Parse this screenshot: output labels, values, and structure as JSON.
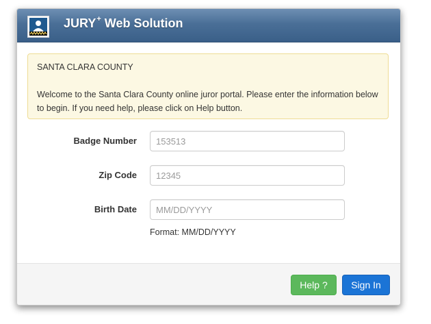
{
  "header": {
    "title": "JURY",
    "title_sup": "+",
    "title_rest": " Web Solution",
    "logo_icon": "jury-box-logo-icon"
  },
  "notice": {
    "county": "SANTA CLARA COUNTY",
    "message": "Welcome to the Santa Clara County online juror portal. Please enter the information below to begin. If you need help, please click on Help button."
  },
  "form": {
    "badge_label": "Badge Number",
    "badge_placeholder": "153513",
    "zip_label": "Zip Code",
    "zip_placeholder": "12345",
    "birth_label": "Birth Date",
    "birth_placeholder": "MM/DD/YYYY",
    "format_hint": "Format: MM/DD/YYYY"
  },
  "footer": {
    "help_label": "Help ?",
    "signin_label": "Sign In"
  },
  "colors": {
    "header": "#4a6f97",
    "notice_bg": "#fcf8e3",
    "help": "#5cb85c",
    "signin": "#1b74d6"
  }
}
